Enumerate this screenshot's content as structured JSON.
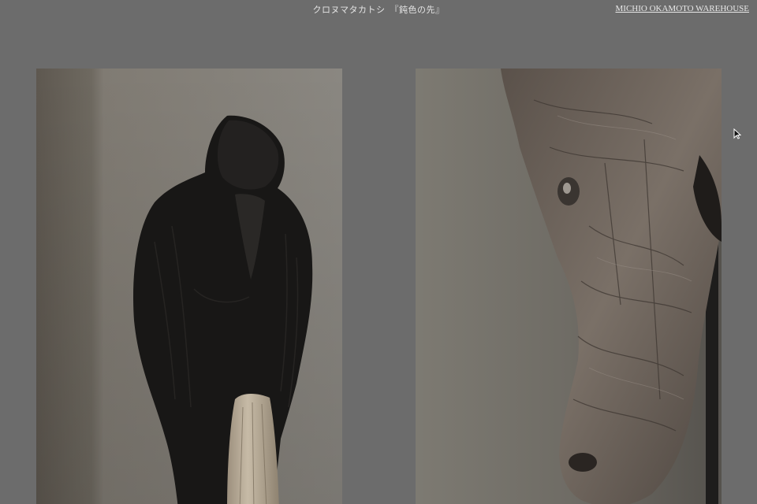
{
  "header": {
    "exhibition_title": "クロヌマタカトシ　『鈍色の先』",
    "site_link_label": "MICHIO OKAMOTO WAREHOUSE"
  },
  "gallery": {
    "images": [
      {
        "subject": "carved black crow sculpture perched on driftwood post"
      },
      {
        "subject": "carved wooden horse head sculpture close-up"
      }
    ]
  },
  "colors": {
    "background": "#6c6c6c",
    "header_text": "#e4e4e4"
  },
  "icons": [
    "mouse-pointer-icon"
  ]
}
